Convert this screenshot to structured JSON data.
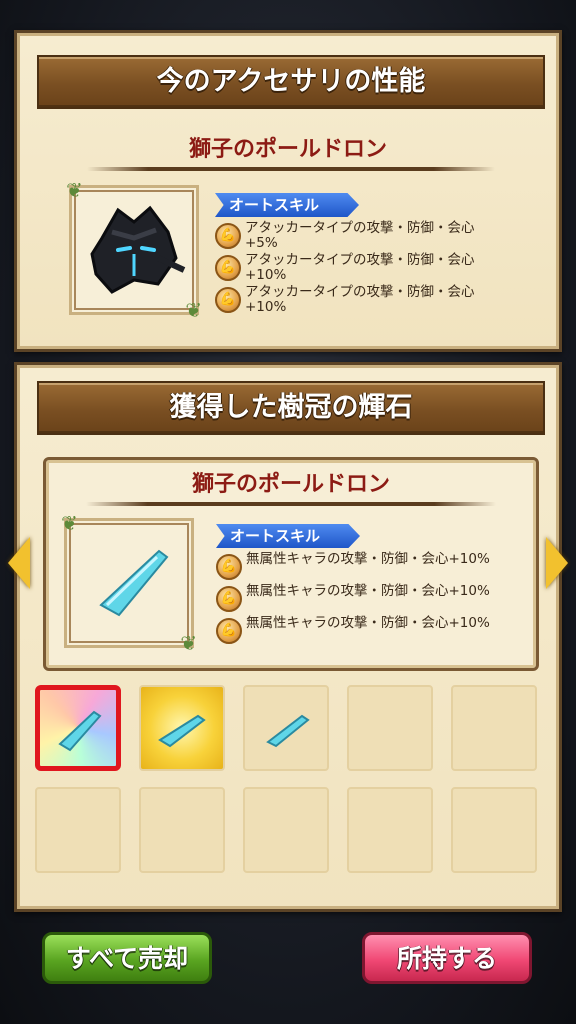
{
  "current_section": {
    "banner": "今のアクセサリの性能",
    "item_name": "獅子のポールドロン",
    "skill_tag": "オートスキル",
    "skills": [
      "アタッカータイプの攻撃・防御・会心+5%",
      "アタッカータイプの攻撃・防御・会心+10%",
      "アタッカータイプの攻撃・防御・会心+10%"
    ]
  },
  "obtained_section": {
    "banner": "獲得した樹冠の輝石",
    "item_name": "獅子のポールドロン",
    "skill_tag": "オートスキル",
    "skills": [
      "無属性キャラの攻撃・防御・会心+10%",
      "無属性キャラの攻撃・防御・会心+10%",
      "無属性キャラの攻撃・防御・会心+10%"
    ]
  },
  "inventory": {
    "slots": [
      {
        "state": "selected-rainbow",
        "icon": "blue-crystal-shard-icon"
      },
      {
        "state": "gold",
        "icon": "blue-crystal-shard-icon"
      },
      {
        "state": "plain",
        "icon": "blue-crystal-shard-icon"
      },
      {
        "state": "empty",
        "icon": ""
      },
      {
        "state": "empty",
        "icon": ""
      },
      {
        "state": "empty",
        "icon": ""
      },
      {
        "state": "empty",
        "icon": ""
      },
      {
        "state": "empty",
        "icon": ""
      },
      {
        "state": "empty",
        "icon": ""
      },
      {
        "state": "empty",
        "icon": ""
      }
    ]
  },
  "buttons": {
    "sell_all": "すべて売却",
    "keep": "所持する"
  },
  "colors": {
    "title_red": "#8c1b14",
    "banner_brown": "#7a4f22",
    "skill_tag_blue": "#1f56c8",
    "selected_border": "#e0161e",
    "sell_green": "#5aa521",
    "keep_pink": "#f04874"
  }
}
